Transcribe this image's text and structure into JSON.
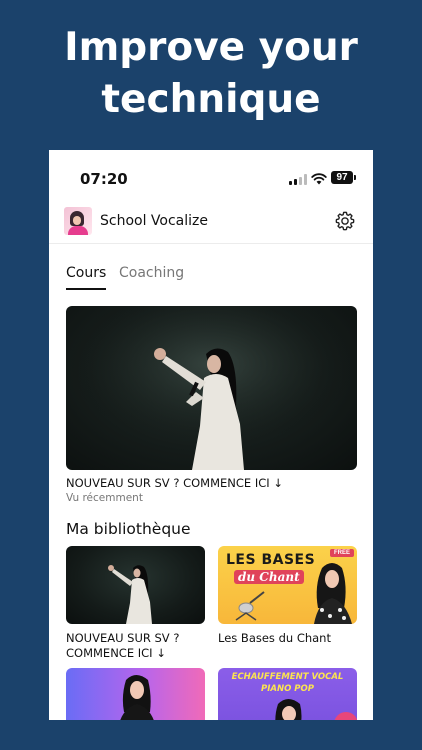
{
  "headline": {
    "line1": "Improve your",
    "line2": "technique"
  },
  "status_bar": {
    "time": "07:20",
    "battery": "97"
  },
  "app": {
    "name": "School Vocalize"
  },
  "tabs": [
    {
      "label": "Cours",
      "active": true
    },
    {
      "label": "Coaching",
      "active": false
    }
  ],
  "hero": {
    "title": "NOUVEAU SUR SV ? COMMENCE ICI ↓",
    "subtitle": "Vu récemment"
  },
  "library": {
    "title": "Ma bibliothèque",
    "items": [
      {
        "title": "NOUVEAU SUR SV ? COMMENCE ICI ↓"
      },
      {
        "title": "Les Bases du Chant",
        "thumb_line1": "LES BASES",
        "thumb_line2": "du Chant",
        "badge": "FREE"
      },
      {
        "title": ""
      },
      {
        "title": "",
        "thumb_text": "ECHAUFFEMENT VOCAL PIANO POP"
      }
    ]
  },
  "colors": {
    "background": "#1b426b",
    "accent_yellow": "#f8b73a",
    "accent_pink": "#e0435a",
    "accent_purple": "#8b5ee9"
  },
  "icons": [
    "cellular-signal-icon",
    "wifi-icon",
    "battery-icon",
    "settings-gear-icon"
  ]
}
